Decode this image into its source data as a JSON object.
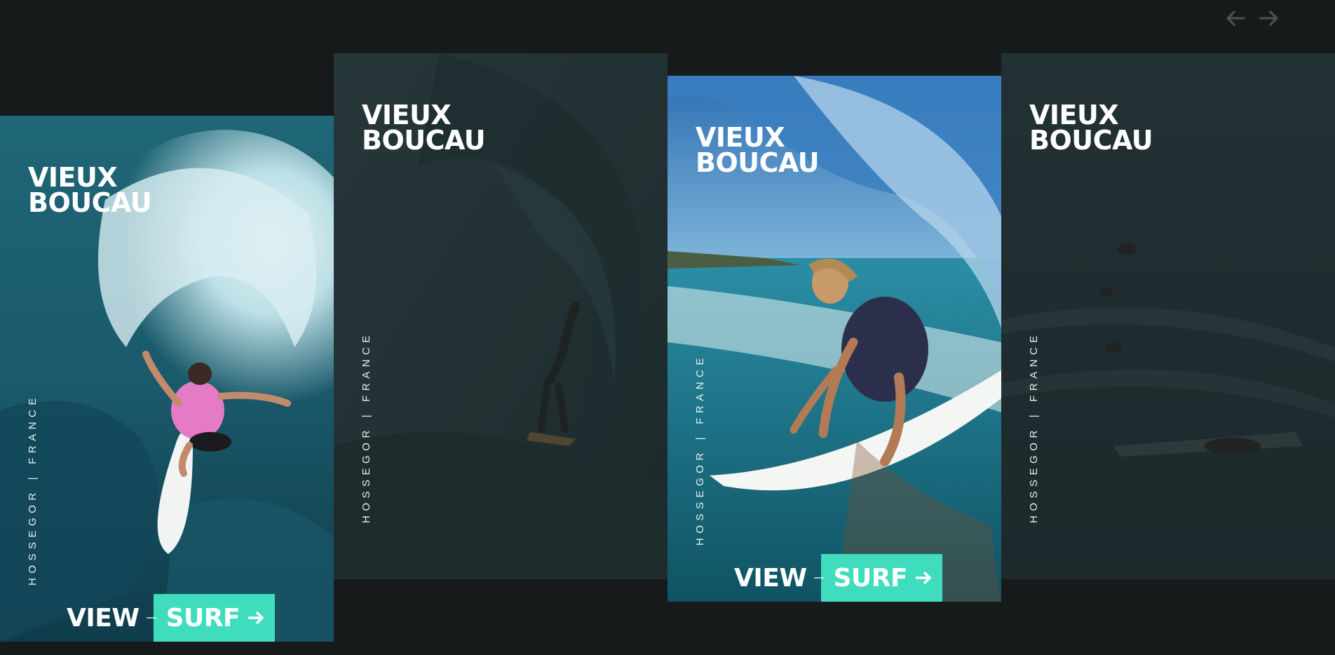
{
  "nav": {
    "prev_icon": "arrow-left-icon",
    "next_icon": "arrow-right-icon",
    "icon_color": "#4a4f4f"
  },
  "accent_color": "#3fdcbd",
  "cards": [
    {
      "title_line1": "VIEUX",
      "title_line2": "BOUCAU",
      "location": "HOSSEGOR",
      "country": "FRANCE",
      "separator": "|",
      "cta_view": "VIEW",
      "cta_surf": "SURF",
      "photo": "surfer-pink-rashguard-wave",
      "active": true
    },
    {
      "title_line1": "VIEUX",
      "title_line2": "BOUCAU",
      "location": "HOSSEGOR",
      "country": "FRANCE",
      "separator": "|",
      "photo": "surfer-barrel-dark",
      "active": false
    },
    {
      "title_line1": "VIEUX",
      "title_line2": "BOUCAU",
      "location": "HOSSEGOR",
      "country": "FRANCE",
      "separator": "|",
      "cta_view": "VIEW",
      "cta_surf": "SURF",
      "photo": "surfer-blue-tube",
      "active": true
    },
    {
      "title_line1": "VIEUX",
      "title_line2": "BOUCAU",
      "location": "HOSSEGOR",
      "country": "FRANCE",
      "separator": "|",
      "photo": "surfers-paddling-ocean",
      "active": false
    }
  ]
}
